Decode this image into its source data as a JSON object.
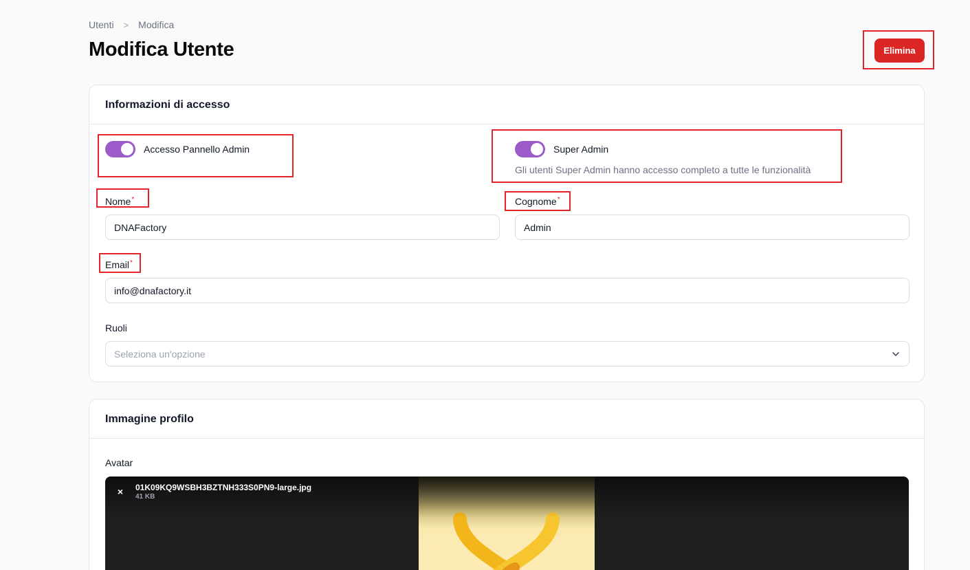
{
  "breadcrumb": {
    "items": [
      "Utenti",
      "Modifica"
    ],
    "separator": ">"
  },
  "page": {
    "title": "Modifica Utente"
  },
  "actions": {
    "delete_label": "Elimina"
  },
  "access_section": {
    "title": "Informazioni di accesso",
    "admin_panel_toggle": {
      "label": "Accesso Pannello Admin",
      "checked": true
    },
    "super_admin_toggle": {
      "label": "Super Admin",
      "checked": true,
      "hint": "Gli utenti Super Admin hanno accesso completo a tutte le funzionalità"
    },
    "first_name": {
      "label": "Nome",
      "required_mark": "*",
      "value": "DNAFactory"
    },
    "last_name": {
      "label": "Cognome",
      "required_mark": "*",
      "value": "Admin"
    },
    "email": {
      "label": "Email",
      "required_mark": "*",
      "value": "info@dnafactory.it"
    },
    "roles": {
      "label": "Ruoli",
      "placeholder": "Seleziona un'opzione"
    }
  },
  "image_section": {
    "title": "Immagine profilo",
    "avatar_label": "Avatar",
    "file": {
      "name": "01K09KQ9WSBH3BZTNH333S0PN9-large.jpg",
      "size": "41 KB",
      "remove_icon": "×"
    }
  },
  "colors": {
    "accent": "#9b5cc9",
    "danger": "#dc2626",
    "annotation": "#e3232a"
  }
}
